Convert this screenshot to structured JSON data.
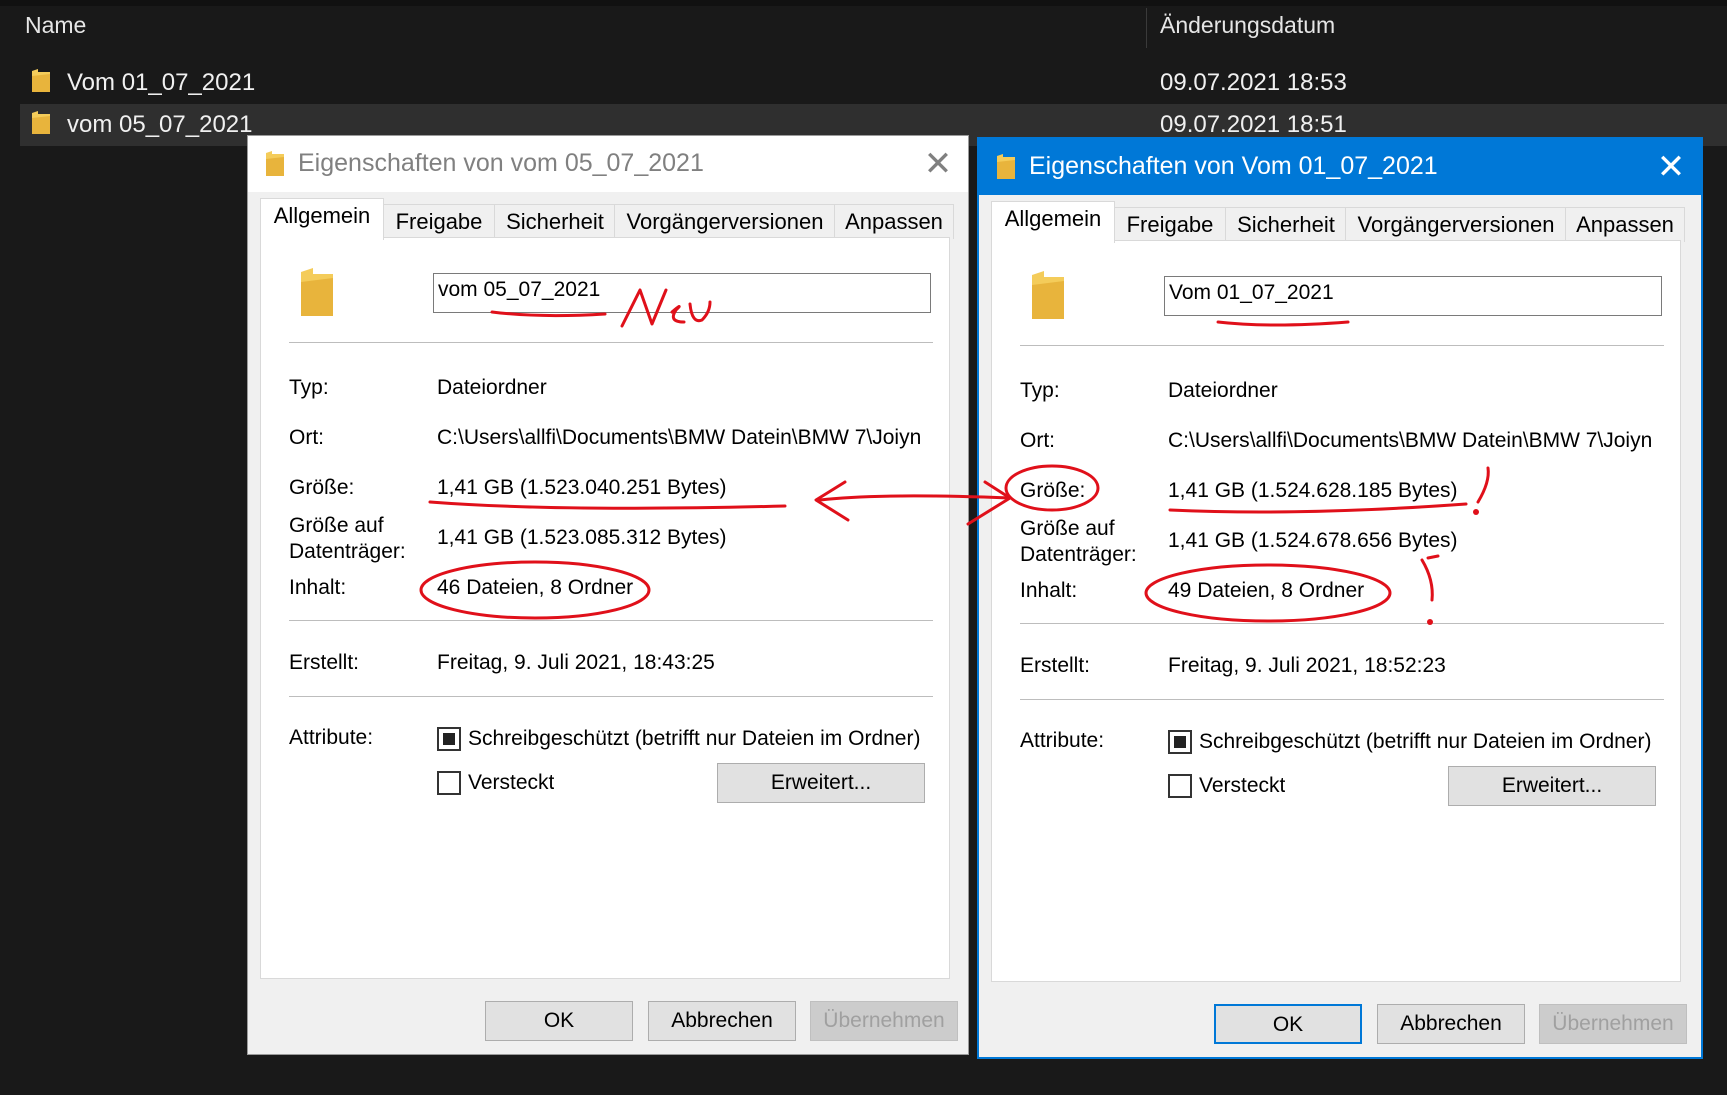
{
  "explorer": {
    "col_name": "Name",
    "col_date": "Änderungsdatum",
    "rows": [
      {
        "name": "Vom 01_07_2021",
        "date": "09.07.2021 18:53"
      },
      {
        "name": "vom 05_07_2021",
        "date": "09.07.2021 18:51"
      }
    ]
  },
  "dialog_left": {
    "title": "Eigenschaften von vom 05_07_2021",
    "close": "✕",
    "tabs": [
      "Allgemein",
      "Freigabe",
      "Sicherheit",
      "Vorgängerversionen",
      "Anpassen"
    ],
    "folder_name": "vom 05_07_2021",
    "typ_label": "Typ:",
    "typ_value": "Dateiordner",
    "ort_label": "Ort:",
    "ort_value": "C:\\Users\\allfi\\Documents\\BMW Datein\\BMW 7\\Joiyn",
    "groesse_label": "Größe:",
    "groesse_value": "1,41 GB (1.523.040.251 Bytes)",
    "gad_label_1": "Größe auf",
    "gad_label_2": "Datenträger:",
    "gad_value": "1,41 GB (1.523.085.312 Bytes)",
    "inhalt_label": "Inhalt:",
    "inhalt_value": "46 Dateien, 8 Ordner",
    "erstellt_label": "Erstellt:",
    "erstellt_value": "Freitag, 9. Juli 2021, 18:43:25",
    "attribute_label": "Attribute:",
    "readonly_label": "Schreibgeschützt (betrifft nur Dateien im Ordner)",
    "hidden_label": "Versteckt",
    "advanced_button": "Erweitert...",
    "ok": "OK",
    "cancel": "Abbrechen",
    "apply": "Übernehmen",
    "annotation": "Neu"
  },
  "dialog_right": {
    "title": "Eigenschaften von Vom 01_07_2021",
    "close": "✕",
    "tabs": [
      "Allgemein",
      "Freigabe",
      "Sicherheit",
      "Vorgängerversionen",
      "Anpassen"
    ],
    "folder_name": "Vom 01_07_2021",
    "typ_label": "Typ:",
    "typ_value": "Dateiordner",
    "ort_label": "Ort:",
    "ort_value": "C:\\Users\\allfi\\Documents\\BMW Datein\\BMW 7\\Joiyn",
    "groesse_label": "Größe:",
    "groesse_value": "1,41 GB (1.524.628.185 Bytes)",
    "gad_label_1": "Größe auf",
    "gad_label_2": "Datenträger:",
    "gad_value": "1,41 GB (1.524.678.656 Bytes)",
    "inhalt_label": "Inhalt:",
    "inhalt_value": "49 Dateien, 8 Ordner",
    "erstellt_label": "Erstellt:",
    "erstellt_value": "Freitag, 9. Juli 2021, 18:52:23",
    "attribute_label": "Attribute:",
    "readonly_label": "Schreibgeschützt (betrifft nur Dateien im Ordner)",
    "hidden_label": "Versteckt",
    "advanced_button": "Erweitert...",
    "ok": "OK",
    "cancel": "Abbrechen",
    "apply": "Übernehmen",
    "annotation": "!"
  },
  "colors": {
    "explorer_bg": "#191919",
    "selected_row": "#2f2f2f",
    "active_titlebar": "#0078d7",
    "annotation_red": "#e0101a",
    "folder_yellow": "#f4cc5a"
  }
}
